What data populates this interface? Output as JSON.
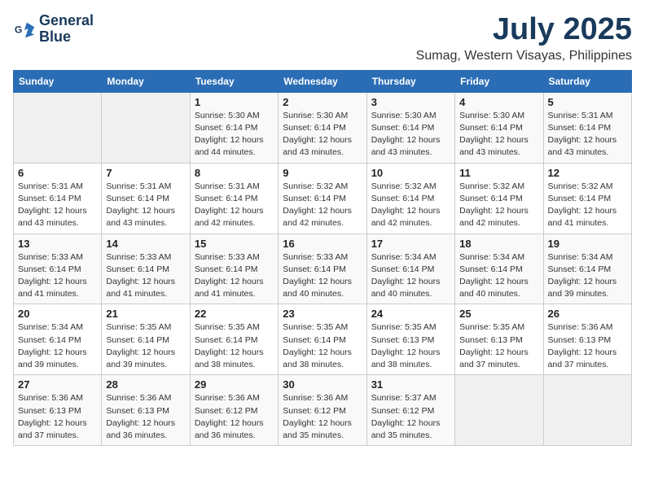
{
  "logo": {
    "line1": "General",
    "line2": "Blue"
  },
  "title": "July 2025",
  "location": "Sumag, Western Visayas, Philippines",
  "days_of_week": [
    "Sunday",
    "Monday",
    "Tuesday",
    "Wednesday",
    "Thursday",
    "Friday",
    "Saturday"
  ],
  "weeks": [
    [
      {
        "day": "",
        "detail": ""
      },
      {
        "day": "",
        "detail": ""
      },
      {
        "day": "1",
        "detail": "Sunrise: 5:30 AM\nSunset: 6:14 PM\nDaylight: 12 hours\nand 44 minutes."
      },
      {
        "day": "2",
        "detail": "Sunrise: 5:30 AM\nSunset: 6:14 PM\nDaylight: 12 hours\nand 43 minutes."
      },
      {
        "day": "3",
        "detail": "Sunrise: 5:30 AM\nSunset: 6:14 PM\nDaylight: 12 hours\nand 43 minutes."
      },
      {
        "day": "4",
        "detail": "Sunrise: 5:30 AM\nSunset: 6:14 PM\nDaylight: 12 hours\nand 43 minutes."
      },
      {
        "day": "5",
        "detail": "Sunrise: 5:31 AM\nSunset: 6:14 PM\nDaylight: 12 hours\nand 43 minutes."
      }
    ],
    [
      {
        "day": "6",
        "detail": "Sunrise: 5:31 AM\nSunset: 6:14 PM\nDaylight: 12 hours\nand 43 minutes."
      },
      {
        "day": "7",
        "detail": "Sunrise: 5:31 AM\nSunset: 6:14 PM\nDaylight: 12 hours\nand 43 minutes."
      },
      {
        "day": "8",
        "detail": "Sunrise: 5:31 AM\nSunset: 6:14 PM\nDaylight: 12 hours\nand 42 minutes."
      },
      {
        "day": "9",
        "detail": "Sunrise: 5:32 AM\nSunset: 6:14 PM\nDaylight: 12 hours\nand 42 minutes."
      },
      {
        "day": "10",
        "detail": "Sunrise: 5:32 AM\nSunset: 6:14 PM\nDaylight: 12 hours\nand 42 minutes."
      },
      {
        "day": "11",
        "detail": "Sunrise: 5:32 AM\nSunset: 6:14 PM\nDaylight: 12 hours\nand 42 minutes."
      },
      {
        "day": "12",
        "detail": "Sunrise: 5:32 AM\nSunset: 6:14 PM\nDaylight: 12 hours\nand 41 minutes."
      }
    ],
    [
      {
        "day": "13",
        "detail": "Sunrise: 5:33 AM\nSunset: 6:14 PM\nDaylight: 12 hours\nand 41 minutes."
      },
      {
        "day": "14",
        "detail": "Sunrise: 5:33 AM\nSunset: 6:14 PM\nDaylight: 12 hours\nand 41 minutes."
      },
      {
        "day": "15",
        "detail": "Sunrise: 5:33 AM\nSunset: 6:14 PM\nDaylight: 12 hours\nand 41 minutes."
      },
      {
        "day": "16",
        "detail": "Sunrise: 5:33 AM\nSunset: 6:14 PM\nDaylight: 12 hours\nand 40 minutes."
      },
      {
        "day": "17",
        "detail": "Sunrise: 5:34 AM\nSunset: 6:14 PM\nDaylight: 12 hours\nand 40 minutes."
      },
      {
        "day": "18",
        "detail": "Sunrise: 5:34 AM\nSunset: 6:14 PM\nDaylight: 12 hours\nand 40 minutes."
      },
      {
        "day": "19",
        "detail": "Sunrise: 5:34 AM\nSunset: 6:14 PM\nDaylight: 12 hours\nand 39 minutes."
      }
    ],
    [
      {
        "day": "20",
        "detail": "Sunrise: 5:34 AM\nSunset: 6:14 PM\nDaylight: 12 hours\nand 39 minutes."
      },
      {
        "day": "21",
        "detail": "Sunrise: 5:35 AM\nSunset: 6:14 PM\nDaylight: 12 hours\nand 39 minutes."
      },
      {
        "day": "22",
        "detail": "Sunrise: 5:35 AM\nSunset: 6:14 PM\nDaylight: 12 hours\nand 38 minutes."
      },
      {
        "day": "23",
        "detail": "Sunrise: 5:35 AM\nSunset: 6:14 PM\nDaylight: 12 hours\nand 38 minutes."
      },
      {
        "day": "24",
        "detail": "Sunrise: 5:35 AM\nSunset: 6:13 PM\nDaylight: 12 hours\nand 38 minutes."
      },
      {
        "day": "25",
        "detail": "Sunrise: 5:35 AM\nSunset: 6:13 PM\nDaylight: 12 hours\nand 37 minutes."
      },
      {
        "day": "26",
        "detail": "Sunrise: 5:36 AM\nSunset: 6:13 PM\nDaylight: 12 hours\nand 37 minutes."
      }
    ],
    [
      {
        "day": "27",
        "detail": "Sunrise: 5:36 AM\nSunset: 6:13 PM\nDaylight: 12 hours\nand 37 minutes."
      },
      {
        "day": "28",
        "detail": "Sunrise: 5:36 AM\nSunset: 6:13 PM\nDaylight: 12 hours\nand 36 minutes."
      },
      {
        "day": "29",
        "detail": "Sunrise: 5:36 AM\nSunset: 6:12 PM\nDaylight: 12 hours\nand 36 minutes."
      },
      {
        "day": "30",
        "detail": "Sunrise: 5:36 AM\nSunset: 6:12 PM\nDaylight: 12 hours\nand 35 minutes."
      },
      {
        "day": "31",
        "detail": "Sunrise: 5:37 AM\nSunset: 6:12 PM\nDaylight: 12 hours\nand 35 minutes."
      },
      {
        "day": "",
        "detail": ""
      },
      {
        "day": "",
        "detail": ""
      }
    ]
  ]
}
